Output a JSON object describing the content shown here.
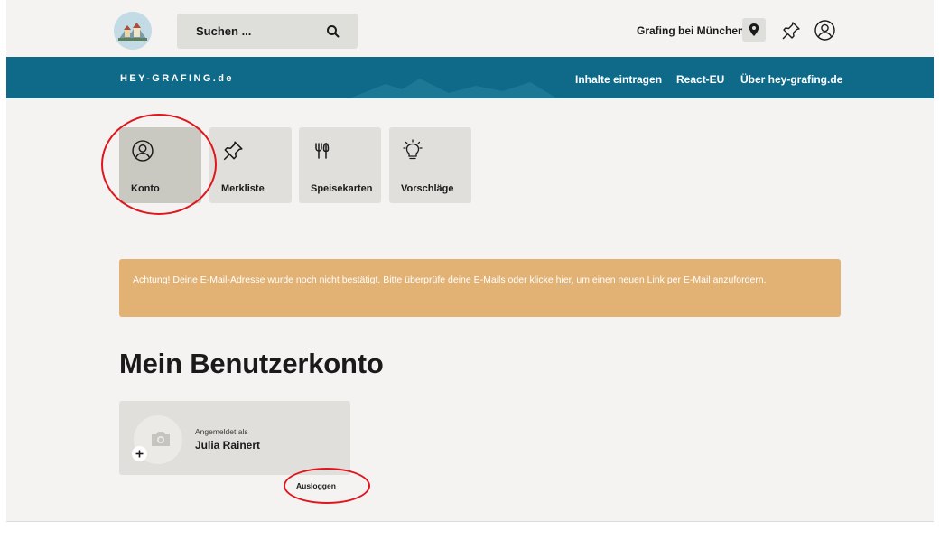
{
  "header": {
    "search": {
      "placeholder": "Suchen ..."
    },
    "location": "Grafing bei München"
  },
  "nav": {
    "brand": "HEY-GRAFING.de",
    "links": [
      "Inhalte eintragen",
      "React-EU",
      "Über hey-grafing.de"
    ]
  },
  "tiles": [
    {
      "label": "Konto",
      "icon": "user-circle-icon",
      "active": true
    },
    {
      "label": "Merkliste",
      "icon": "pin-icon"
    },
    {
      "label": "Speisekarten",
      "icon": "fork-knife-icon"
    },
    {
      "label": "Vorschläge",
      "icon": "lightbulb-icon"
    }
  ],
  "alert": {
    "text_before": "Achtung! Deine E-Mail-Adresse wurde noch nicht bestätigt. Bitte überprüfe deine E-Mails oder klicke ",
    "link": "hier",
    "text_after": ", um einen neuen Link per E-Mail anzufordern."
  },
  "page_title": "Mein Benutzerkonto",
  "account": {
    "signed_in_label": "Angemeldet als",
    "name": "Julia Rainert",
    "logout": "Ausloggen"
  },
  "colors": {
    "nav_blue": "#0f6a8a",
    "alert_orange": "#e2b275",
    "annotation_red": "#e0161e"
  }
}
